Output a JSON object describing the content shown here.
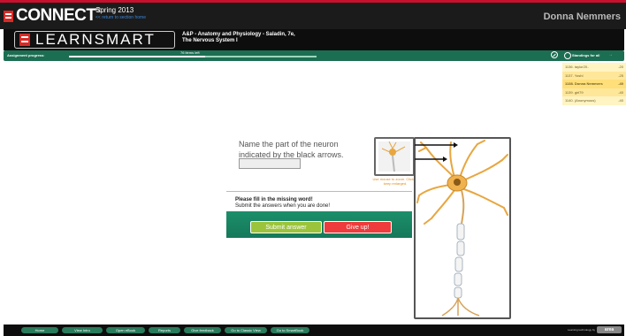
{
  "header": {
    "brand": "CONNECT",
    "term": "Spring 2013",
    "term_link": "<< return to section home",
    "user": "Donna Nemmers"
  },
  "learnsmart": {
    "title": "LEARNSMART",
    "course_line1": "A&P - Anatomy and Physiology - Saladin, 7e,",
    "course_line2": "The Nervous System I"
  },
  "progress": {
    "label": "Assignment progress:",
    "items_left": "76 items left",
    "fraction": 0.55
  },
  "standings": {
    "title": "Standings for all",
    "rows": [
      {
        "name": "1136. taylor20..",
        "score": "-20",
        "me": false
      },
      {
        "name": "1137. YoshI",
        "score": "-25",
        "me": false
      },
      {
        "name": "1138. Donna Nemmers",
        "score": "-40",
        "me": true
      },
      {
        "name": "1139. girl79",
        "score": "-40",
        "me": false
      },
      {
        "name": "1140. (Anonymous)",
        "score": "-40",
        "me": false
      }
    ]
  },
  "question": {
    "text": "Name the part of the neuron indicated by the black arrows.",
    "mouse_note": "Use mouse to zoom. Click to keep enlarged."
  },
  "feedback": {
    "title": "Please fill in the missing word!",
    "subtitle": "Submit the answers when you are done!",
    "submit_label": "Submit answer",
    "giveup_label": "Give up!"
  },
  "nav": {
    "items": [
      "Home",
      "View Intro",
      "Open eBook",
      "Reports",
      "Give feedback",
      "Go to Classic View",
      "Go to SmartBook"
    ],
    "tagline": "Learning technology by",
    "area_logo": "area"
  },
  "colors": {
    "brand_red": "#c8102e",
    "green": "#1c6e52",
    "submit": "#9bc43c",
    "giveup": "#ef3b3b"
  }
}
